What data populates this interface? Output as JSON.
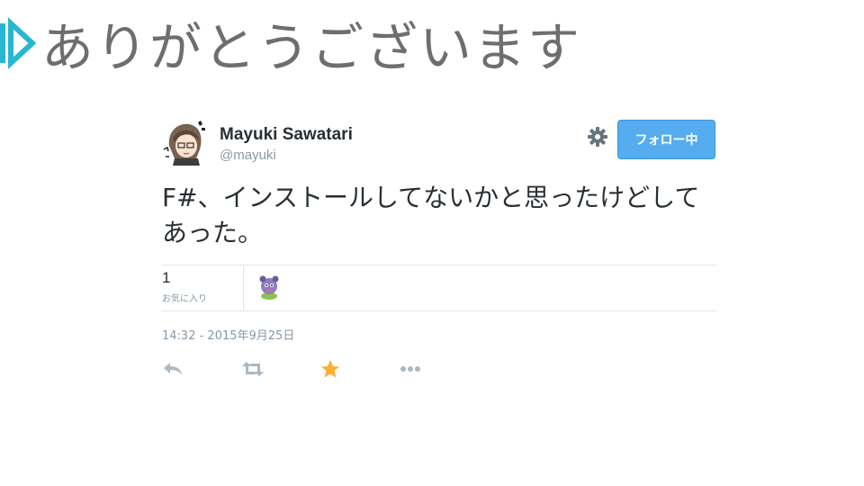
{
  "slide": {
    "title": "ありがとうございます",
    "marker_color": "#29b6d1"
  },
  "tweet": {
    "author_name": "Mayuki Sawatari",
    "author_handle": "@mayuki",
    "follow_label": "フォロー中",
    "text": "F#、インストールしてないかと思ったけどしてあった。",
    "favorites_count": "1",
    "favorites_label": "お気に入り",
    "timestamp": "14:32 - 2015年9月25日",
    "icons": {
      "settings": "gear-icon",
      "reply": "reply-icon",
      "retweet": "retweet-icon",
      "favorite": "star-icon",
      "more": "more-icon"
    },
    "colors": {
      "follow_button": "#55acee",
      "favorite_star": "#ffac33",
      "muted": "#8899a6"
    }
  }
}
